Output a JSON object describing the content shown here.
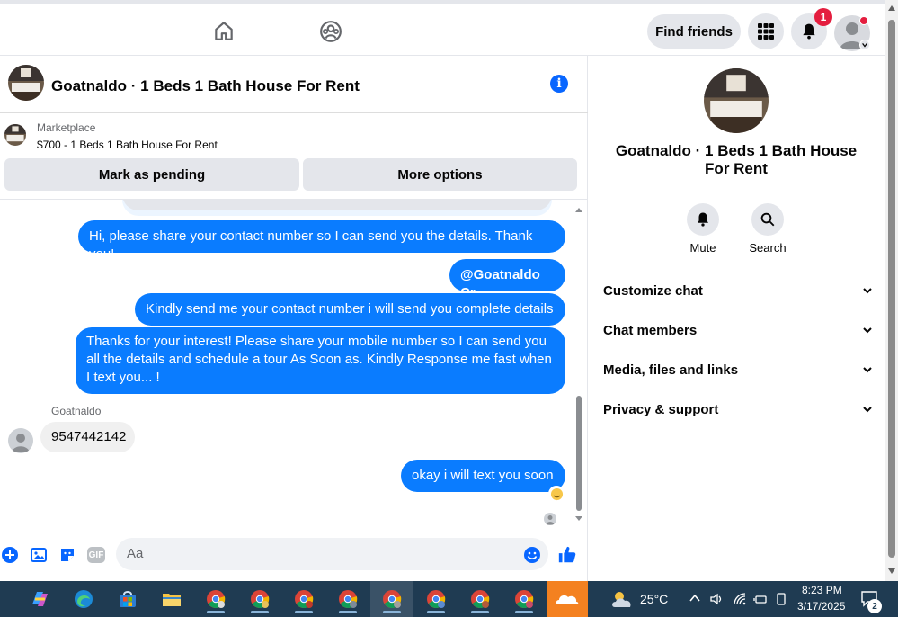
{
  "topbar": {
    "find_friends": "Find friends",
    "notification_count": "1",
    "icons": [
      "home-icon",
      "groups-icon",
      "menu-grid-icon",
      "bell-icon",
      "profile-avatar"
    ]
  },
  "chat": {
    "title": "Goatnaldo · 1 Beds 1 Bath House For Rent",
    "marketplace_label": "Marketplace",
    "listing": "$700 - 1 Beds 1 Bath House For Rent",
    "mark_pending": "Mark as pending",
    "more_options": "More options",
    "messages": [
      {
        "dir": "out",
        "text": "Hi, please share your contact number so I can send you the details. Thank you!"
      },
      {
        "dir": "out",
        "text": "@Goatnaldo Cr"
      },
      {
        "dir": "out",
        "text": "Kindly send me your contact number i will send you complete details"
      },
      {
        "dir": "out",
        "text": "Thanks for your interest! Please share your mobile number so I can send you all the details and schedule a tour As Soon as. Kindly Response me fast when I text you... !"
      },
      {
        "dir": "in",
        "sender": "Goatnaldo",
        "text": "9547442142"
      },
      {
        "dir": "out",
        "text": "okay i will text you soon"
      }
    ],
    "composer_placeholder": "Aa",
    "gif_label": "GIF"
  },
  "sidebar": {
    "title": "Goatnaldo · 1 Beds 1 Bath House For Rent",
    "actions": [
      {
        "label": "Mute"
      },
      {
        "label": "Search"
      }
    ],
    "menu": [
      {
        "label": "Customize chat"
      },
      {
        "label": "Chat members"
      },
      {
        "label": "Media, files and links"
      },
      {
        "label": "Privacy & support"
      }
    ]
  },
  "taskbar": {
    "temperature": "25°C",
    "time": "8:23 PM",
    "date": "3/17/2025",
    "notif_count": "2"
  },
  "colors": {
    "accent": "#0a7cff",
    "brand": "#0866ff",
    "badge": "#e41e3f",
    "taskbar": "#1f3b52"
  }
}
